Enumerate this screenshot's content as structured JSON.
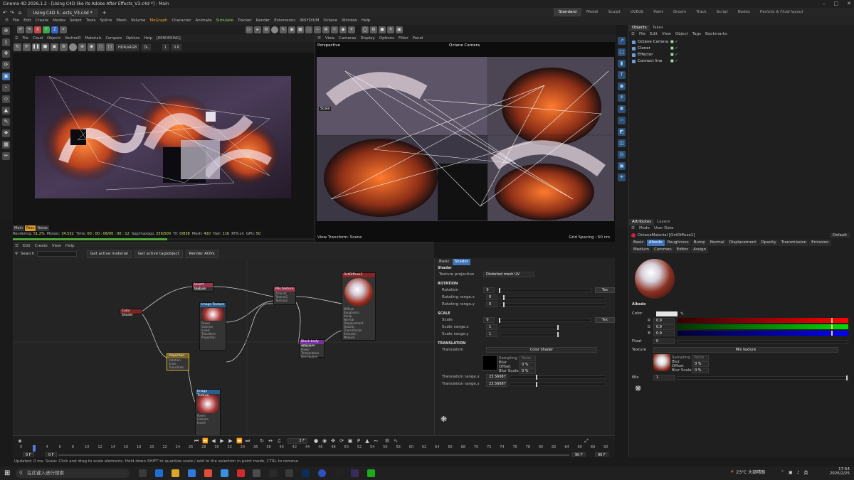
{
  "window": {
    "title": "Cinema 4D 2026.1.2 - [Using C4D like its Adobe After Effects_V3.c4d *] - Main",
    "doc_tab": "Using C4D li...ects_V3.c4d *",
    "new_tab": "+"
  },
  "layouts": [
    {
      "label": "Standard",
      "active": true
    },
    {
      "label": "Model"
    },
    {
      "label": "Sculpt"
    },
    {
      "label": "UVEdit"
    },
    {
      "label": "Paint"
    },
    {
      "label": "Groom"
    },
    {
      "label": "Track"
    },
    {
      "label": "Script"
    },
    {
      "label": "Nodes"
    },
    {
      "label": "Particle & Fluid layout",
      "italic": true
    }
  ],
  "menu": [
    "File",
    "Edit",
    "Create",
    "Modes",
    "Select",
    "Tools",
    "Spline",
    "Mesh",
    "Volume",
    "MoGraph",
    "Character",
    "Animate",
    "Simulate",
    "Tracker",
    "Render",
    "Extensions",
    "INSYDIUM",
    "Octane",
    "Window",
    "Help"
  ],
  "menu_highlight": {
    "MoGraph": "orange",
    "Simulate": "green"
  },
  "axis_buttons": [
    "X",
    "Y",
    "Z"
  ],
  "render_viewer": {
    "menu": [
      "File",
      "Cloud",
      "Objects",
      "VectronR",
      "Materials",
      "Compare",
      "Options",
      "Help",
      "[RENDERING]"
    ],
    "colorspace": "HDR/sRGB",
    "mode": "DL",
    "value1": "1",
    "value2": "0.6",
    "tabs": [
      {
        "label": "Main"
      },
      {
        "label": "Pass",
        "active": true
      },
      {
        "label": "Noise"
      }
    ],
    "stats": {
      "rendering_label": "Rendering:",
      "rendering": "51.2%",
      "mssec_label": "Ms/sec:",
      "mssec": "34.532",
      "time_label": "Time:",
      "time": "00 : 00 : 06/00 : 00 : 12",
      "spp_label": "Spp/maxspp:",
      "spp": "256/500",
      "tri_label": "Tri:",
      "tri": "0/838",
      "mesh_label": "Mesh:",
      "mesh": "420",
      "hair_label": "Hair:",
      "hair": "116",
      "rtx_label": "RTX:on",
      "gpu_label": "GPU:",
      "gpu": "50"
    },
    "progress": 0.512
  },
  "viewport": {
    "menu": [
      "View",
      "Cameras",
      "Display",
      "Options",
      "Filter",
      "Panel"
    ],
    "label_left": "Perspective",
    "label_center": "Octane Camera",
    "scale_label": "Scale",
    "footer_left": "View Transform: Scene",
    "footer_right": "Grid Spacing : 50 cm"
  },
  "object_manager": {
    "tabs": [
      {
        "label": "Objects",
        "active": true
      },
      {
        "label": "Takes"
      }
    ],
    "menu": [
      "File",
      "Edit",
      "View",
      "Object",
      "Tags",
      "Bookmarks"
    ],
    "objects": [
      "Octane Camera",
      "Cloner",
      "Effector",
      "Connect line"
    ]
  },
  "attribute_manager": {
    "tabs": [
      {
        "label": "Attributes",
        "active": true
      },
      {
        "label": "Layers"
      }
    ],
    "menu": [
      "Mode",
      "User Data"
    ],
    "material_name": "OctaneMaterial [OctDiffuse1]",
    "preset": "Default",
    "chan_tabs_row1": [
      {
        "label": "Basic"
      },
      {
        "label": "Albedo",
        "active": true
      },
      {
        "label": "Roughness"
      },
      {
        "label": "Bump"
      },
      {
        "label": "Normal"
      },
      {
        "label": "Displacement"
      },
      {
        "label": "Opacity"
      },
      {
        "label": "Transmission"
      },
      {
        "label": "Emission"
      }
    ],
    "chan_tabs_row2": [
      {
        "label": "Medium"
      },
      {
        "label": "Common"
      },
      {
        "label": "Editor"
      },
      {
        "label": "Assign"
      }
    ],
    "section": "Albedo",
    "color_label": "Color",
    "rgb": [
      {
        "ch": "R",
        "val": "0.9"
      },
      {
        "ch": "G",
        "val": "0.9"
      },
      {
        "ch": "B",
        "val": "0.9"
      }
    ],
    "float_label": "Float",
    "float_val": "0",
    "texture_label": "Texture",
    "texture_name": "Mix texture",
    "sampling_label": "Sampling",
    "sampling_val": "None",
    "blur_offset_label": "Blur Offset",
    "blur_offset": "0 %",
    "blur_scale_label": "Blur Scale",
    "blur_scale": "0 %",
    "mix_label": "Mix",
    "mix_val": "1"
  },
  "node_editor": {
    "menu": [
      "Edit",
      "Create",
      "View",
      "Help"
    ],
    "search_label": "Search",
    "buttons": [
      "Get active material",
      "Get active tag/object",
      "Render AOVs"
    ],
    "nodes": {
      "color_shader": {
        "title": "Color Shader"
      },
      "invert": {
        "title": "Invert texture",
        "lines": [
          "Texture"
        ]
      },
      "image1": {
        "title": "Image Texture",
        "lines": [
          "Power",
          "Gamma",
          "Invert",
          "Transform",
          "Projection"
        ]
      },
      "projection": {
        "title": "Projection",
        "lines": [
          "Rotation",
          "Scale",
          "Translation"
        ]
      },
      "image2": {
        "title": "Image Texture",
        "lines": [
          "Power",
          "Gamma",
          "Invert"
        ]
      },
      "mix": {
        "title": "Mix texture",
        "lines": [
          "Amount",
          "Texture1",
          "Texture2"
        ]
      },
      "blackbody": {
        "title": "Black body emission",
        "lines": [
          "Texture",
          "Power",
          "Temperature",
          "Distribution"
        ]
      },
      "material": {
        "title": "OctDiffuse1",
        "lines": [
          "Diffuse",
          "Roughness",
          "Bump",
          "Normal",
          "Displacement",
          "Opacity",
          "Transmission",
          "Emission",
          "Medium"
        ]
      }
    }
  },
  "shader_panel": {
    "tabs": [
      {
        "label": "Basic"
      },
      {
        "label": "Shader",
        "active": true
      }
    ],
    "title": "Shader",
    "texture_projection_label": "Texture projection",
    "texture_projection": "Distorted mesh UV",
    "sections": {
      "rotation": "ROTATION",
      "scale": "SCALE",
      "translation": "TRANSLATION"
    },
    "rotation": {
      "label": "Rotation",
      "val": "0"
    },
    "rot_range_x": {
      "label": "Rotating range.x",
      "val": "0"
    },
    "rot_range_y": {
      "label": "Rotating range.y",
      "val": "0"
    },
    "scale": {
      "label": "Scale",
      "val": "0"
    },
    "scale_range_x": {
      "label": "Scale range.x",
      "val": "1"
    },
    "scale_range_y": {
      "label": "Scale range.y",
      "val": "1"
    },
    "translation_label": "Translation",
    "color_shader": "Color Shader",
    "sampling_label": "Sampling",
    "sampling_val": "None",
    "blur_offset_label": "Blur Offset",
    "blur_offset": "0 %",
    "blur_scale_label": "Blur Scale",
    "blur_scale": "0 %",
    "trans_range_x": {
      "label": "Translation range.x",
      "val": "23.56687"
    },
    "trans_range_y": {
      "label": "Translation range.y",
      "val": "23.56687"
    },
    "tex_button": "Tex"
  },
  "timeline": {
    "current_frame": "2 F",
    "ruler": [
      "0",
      "2",
      "4",
      "6",
      "8",
      "10",
      "12",
      "14",
      "16",
      "18",
      "20",
      "22",
      "24",
      "26",
      "28",
      "30",
      "32",
      "34",
      "36",
      "38",
      "40",
      "42",
      "44",
      "46",
      "48",
      "50",
      "52",
      "54",
      "56",
      "58",
      "60",
      "62",
      "64",
      "66",
      "68",
      "70",
      "72",
      "74",
      "76",
      "78",
      "80",
      "82",
      "84",
      "86",
      "88",
      "90"
    ],
    "start": "0 F",
    "start2": "0 F",
    "end": "90 F",
    "end2": "90 F"
  },
  "status_bar": "Updated: 0 ms.    Scale: Click and drag to scale elements. Hold down SHIFT to quantize scale / add to the selection in point mode, CTRL to remove.",
  "taskbar": {
    "search_placeholder": "在此键入进行搜索",
    "weather": "23°C 大部晴朗",
    "ime": "英",
    "time": "17:54",
    "date": "2026/2/25"
  }
}
